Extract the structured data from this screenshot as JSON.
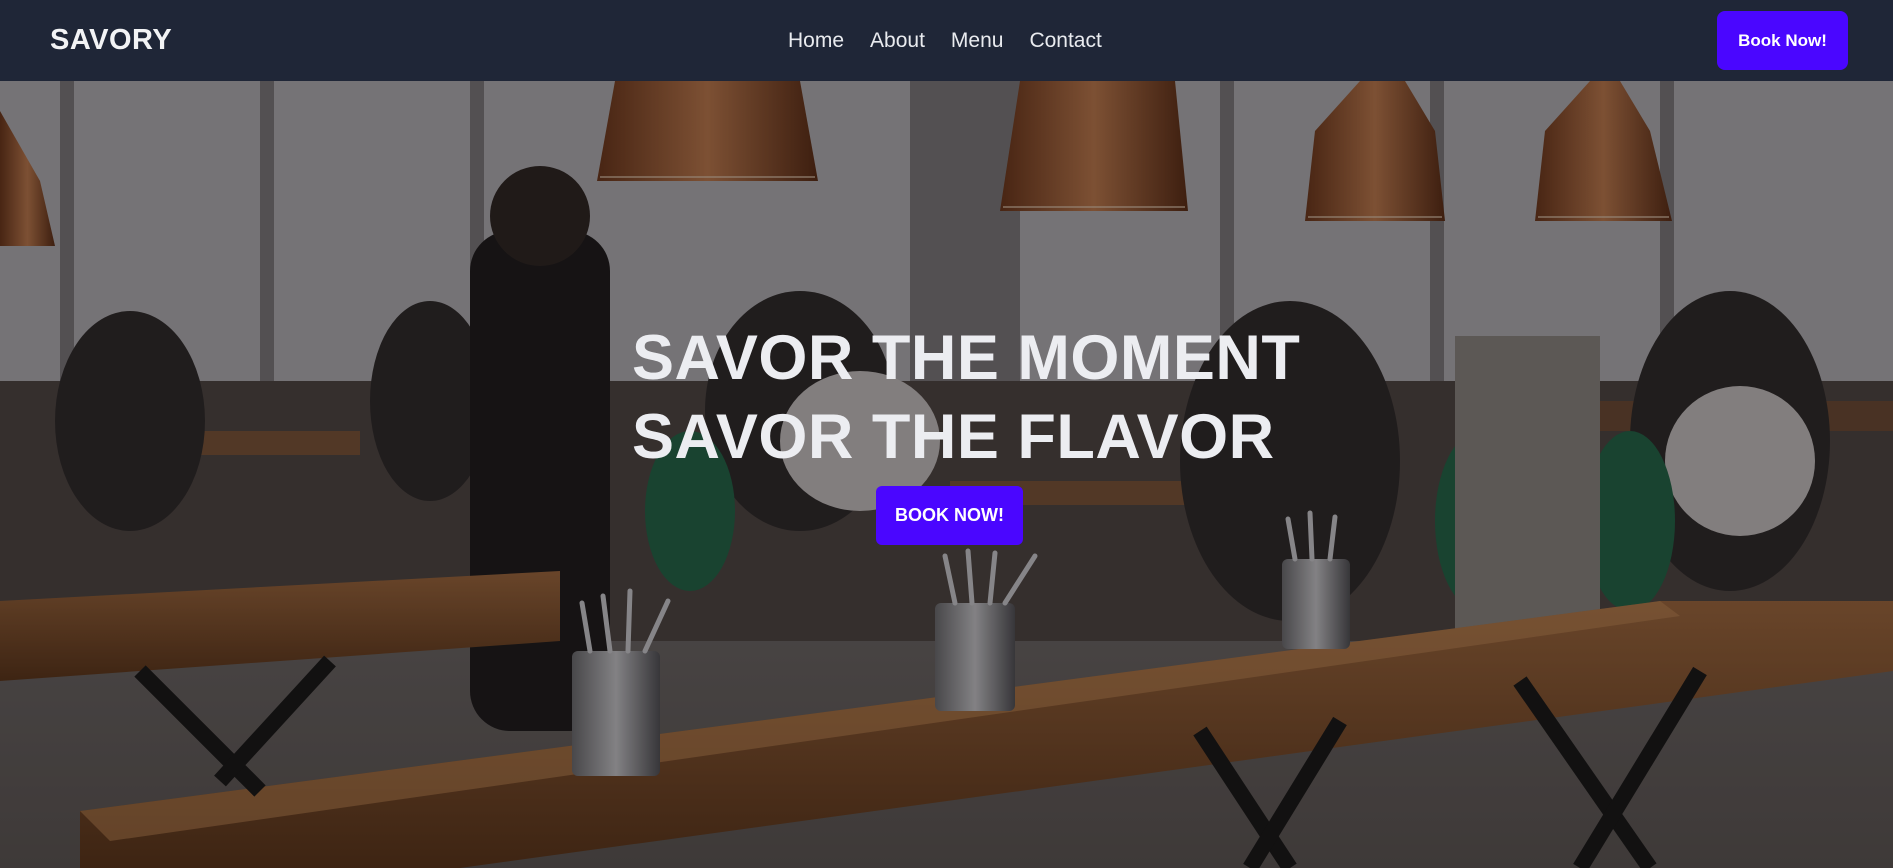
{
  "brand": {
    "name": "SAVORY"
  },
  "nav": {
    "links": [
      {
        "label": "Home"
      },
      {
        "label": "About"
      },
      {
        "label": "Menu"
      },
      {
        "label": "Contact"
      }
    ],
    "cta_label": "Book Now!"
  },
  "hero": {
    "title_line1": "SAVOR THE MOMENT",
    "title_line2": "SAVOR THE FLAVOR",
    "cta_label": "BOOK NOW!",
    "background_icon": "restaurant-interior-photo"
  },
  "colors": {
    "navbar_bg": "#1f2637",
    "accent": "#4a06ff",
    "text_light": "#ecedf1"
  }
}
